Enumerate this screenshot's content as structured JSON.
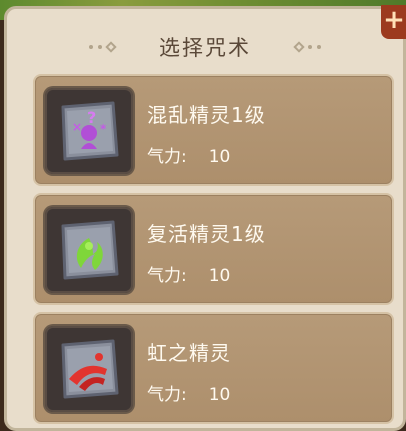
{
  "title": "选择咒术",
  "spells": [
    {
      "name": "混乱精灵1级",
      "stat_label": "气力:",
      "stat_value": "10",
      "icon": "confusion-spirit-icon",
      "color": "#b14fd6"
    },
    {
      "name": "复活精灵1级",
      "stat_label": "气力:",
      "stat_value": "10",
      "icon": "revive-spirit-icon",
      "color": "#7fd63a"
    },
    {
      "name": "虹之精灵",
      "stat_label": "气力:",
      "stat_value": "10",
      "icon": "rainbow-spirit-icon",
      "color": "#e2342e"
    }
  ]
}
